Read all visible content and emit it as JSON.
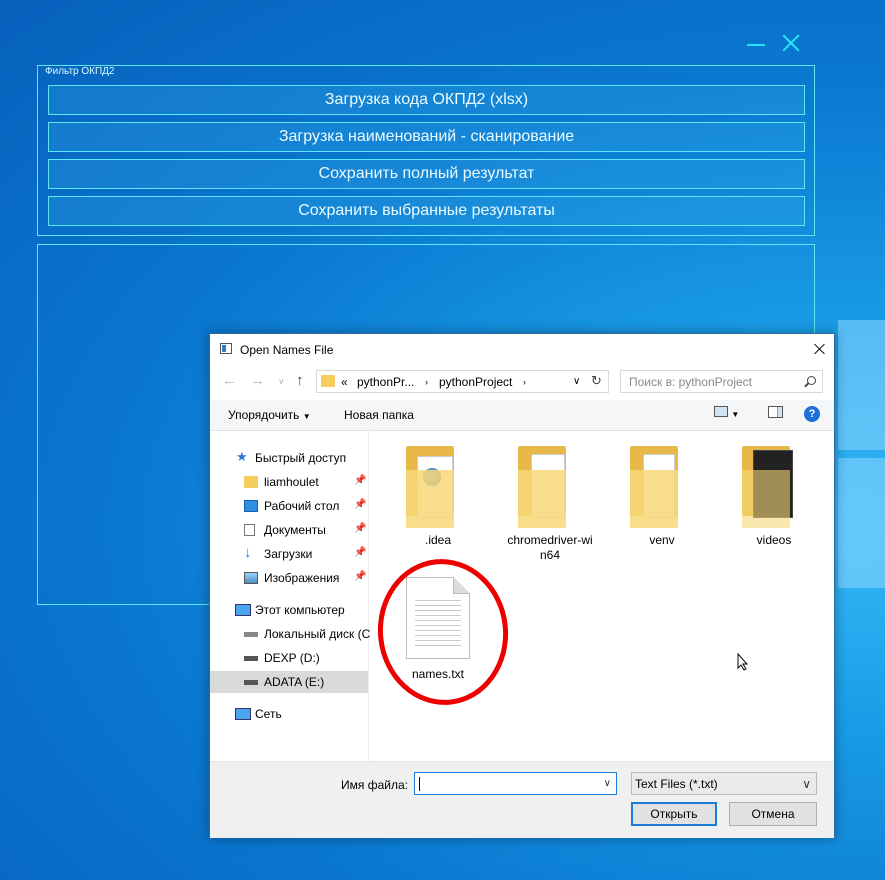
{
  "app": {
    "group_title": "Фильтр ОКПД2",
    "buttons": [
      "Загрузка кода ОКПД2 (xlsx)",
      "Загрузка наименований - сканирование",
      "Сохранить полный результат",
      "Сохранить выбранные результаты"
    ]
  },
  "dialog": {
    "title": "Open Names File",
    "address": {
      "prefix": "«",
      "crumb1": "pythonPr...",
      "crumb2": "pythonProject"
    },
    "search_placeholder": "Поиск в: pythonProject",
    "toolbar": {
      "organize": "Упорядочить",
      "new_folder": "Новая папка",
      "help": "?"
    },
    "sidebar": [
      {
        "label": "Быстрый доступ",
        "icon": "star-icon"
      },
      {
        "label": "liamhoulet",
        "icon": "folder-icon",
        "pin": true
      },
      {
        "label": "Рабочий стол",
        "icon": "desktop-icon",
        "pin": true
      },
      {
        "label": "Документы",
        "icon": "documents-icon",
        "pin": true
      },
      {
        "label": "Загрузки",
        "icon": "download-icon",
        "pin": true
      },
      {
        "label": "Изображения",
        "icon": "pictures-icon",
        "pin": true
      },
      {
        "label": "Этот компьютер",
        "icon": "computer-icon"
      },
      {
        "label": "Локальный диск (C",
        "icon": "drive-icon"
      },
      {
        "label": "DEXP (D:)",
        "icon": "drive-icon"
      },
      {
        "label": "ADATA (E:)",
        "icon": "drive-icon"
      },
      {
        "label": "Сеть",
        "icon": "network-icon"
      }
    ],
    "files": [
      {
        "name": ".idea",
        "type": "folder"
      },
      {
        "name": "chromedriver-wi\nn64",
        "type": "folder"
      },
      {
        "name": "venv",
        "type": "folder"
      },
      {
        "name": "videos",
        "type": "folder"
      },
      {
        "name": "names.txt",
        "type": "txt"
      }
    ],
    "filename_label": "Имя файла:",
    "filename_value": "",
    "filter_value": "Text Files (*.txt)",
    "open_label": "Открыть",
    "cancel_label": "Отмена"
  }
}
